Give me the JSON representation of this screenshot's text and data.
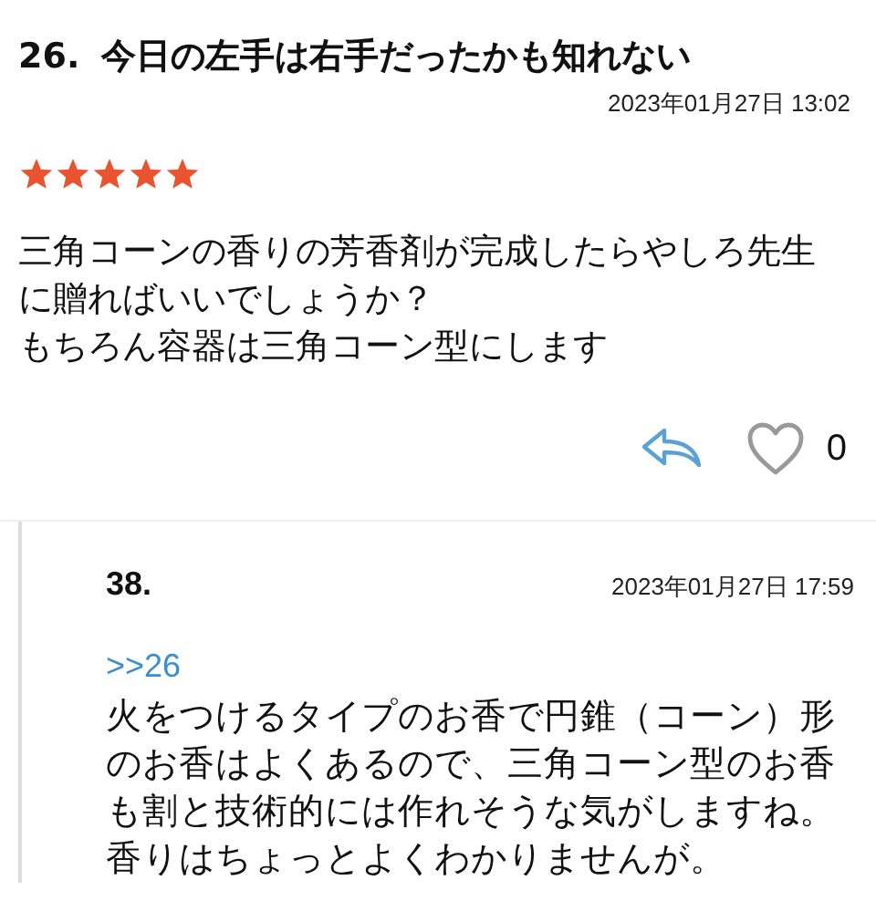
{
  "post": {
    "number": "26.",
    "title": "今日の左手は右手だったかも知れない",
    "date": "2023年01月27日 13:02",
    "stars": 5,
    "body": [
      "三角コーンの香りの芳香剤が完成したらやしろ先生に贈ればいいでしょうか？",
      "もちろん容器は三角コーン型にします"
    ],
    "like_count": "0",
    "liked": false
  },
  "reply": {
    "number": "38.",
    "date": "2023年01月27日 17:59",
    "anchor": ">>26",
    "body": "火をつけるタイプのお香で円錐（コーン）形のお香はよくあるので、三角コーン型のお香も割と技術的には作れそうな気がしますね。香りはちょっとよくわかりませんが。"
  }
}
